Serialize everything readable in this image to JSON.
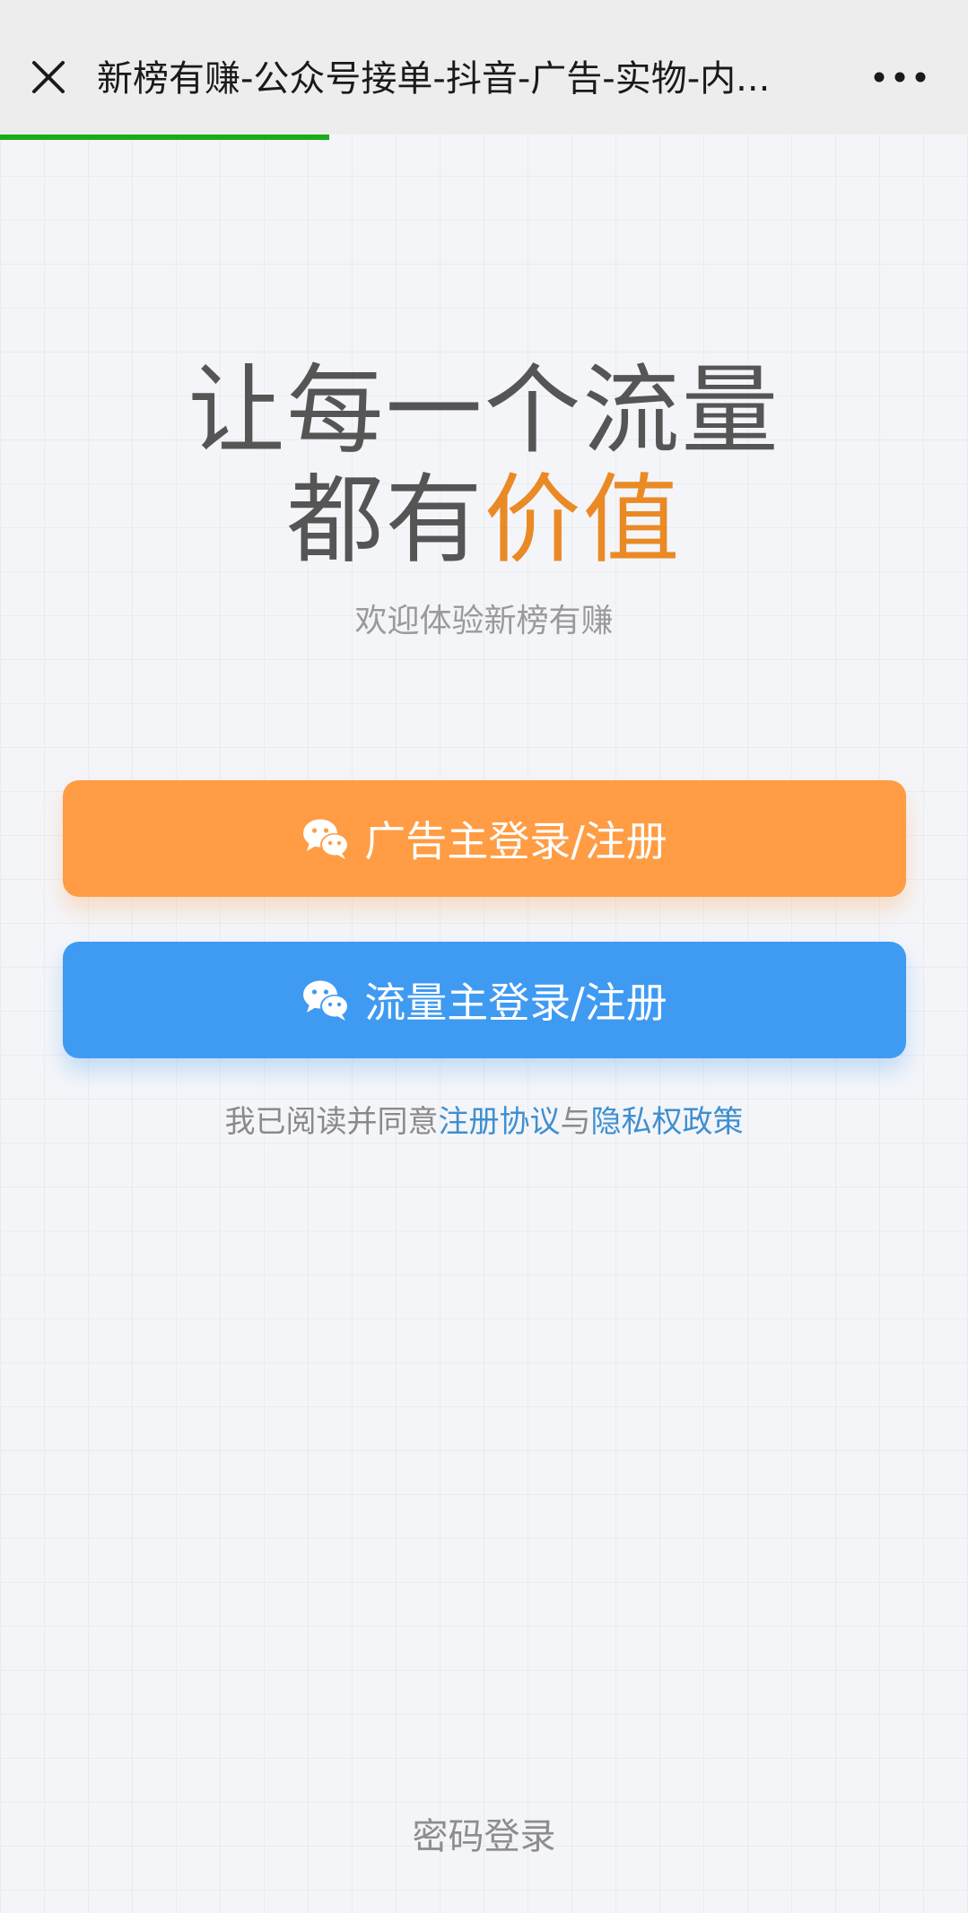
{
  "header": {
    "title": "新榜有赚-公众号接单-抖音-广告-实物-内...",
    "load_progress_percent": 34
  },
  "hero": {
    "line1": "让每一个流量",
    "line2_prefix": "都有",
    "line2_accent": "价值",
    "subtitle": "欢迎体验新榜有赚"
  },
  "buttons": {
    "advertiser_label": "广告主登录/注册",
    "traffic_label": "流量主登录/注册"
  },
  "agreement": {
    "prefix": "我已阅读并同意",
    "terms_link": "注册协议",
    "connector": "与",
    "privacy_link": "隐私权政策"
  },
  "footer": {
    "password_login": "密码登录"
  },
  "colors": {
    "advertiser": "#ff9c44",
    "traffic": "#3f9af2",
    "accent": "#ea8a24",
    "link": "#3f8fcf",
    "progress": "#1aad19"
  },
  "icons": {
    "close": "close-icon",
    "more": "more-dots-icon",
    "wechat": "wechat-icon"
  }
}
